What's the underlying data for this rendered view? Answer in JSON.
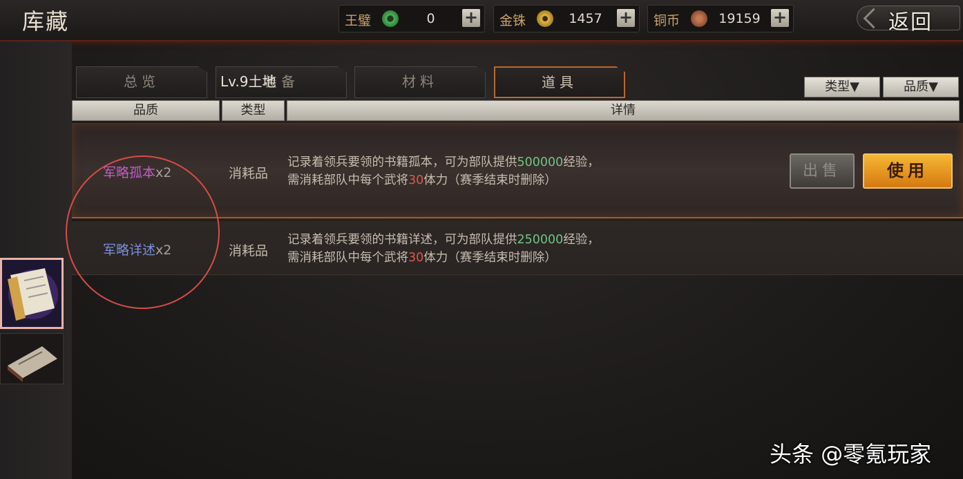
{
  "header": {
    "title": "库藏",
    "back_label": "返回"
  },
  "currencies": [
    {
      "name": "王璧",
      "value": "0",
      "color": "#4fb357"
    },
    {
      "name": "金铢",
      "value": "1457",
      "color": "#c59a2a"
    },
    {
      "name": "铜币",
      "value": "19159",
      "color": "#a0593a"
    }
  ],
  "tabs": [
    {
      "label": "总览"
    },
    {
      "label": "装备",
      "overlay": "Lv.9土地"
    },
    {
      "label": "材料"
    },
    {
      "label": "道具",
      "active": true
    }
  ],
  "filters": {
    "type_label": "类型▼",
    "quality_label": "品质▼"
  },
  "table": {
    "headers": [
      "品质",
      "类型",
      "详情"
    ]
  },
  "items": [
    {
      "name": "军略孤本",
      "name_color": "#c25cc8",
      "qty": "x2",
      "type": "消耗品",
      "desc_a": "记录着领兵要领的书籍孤本，可为部队提供",
      "exp": "500000",
      "desc_b": "经验，",
      "desc_c": "需消耗部队中每个武将",
      "stamina": "30",
      "desc_d": "体力（赛季结束时删除）"
    },
    {
      "name": "军略详述",
      "name_color": "#7a8fd8",
      "qty": "x2",
      "type": "消耗品",
      "desc_a": "记录着领兵要领的书籍详述，可为部队提供",
      "exp": "250000",
      "desc_b": "经验，",
      "desc_c": "需消耗部队中每个武将",
      "stamina": "30",
      "desc_d": "体力（赛季结束时删除）"
    }
  ],
  "actions": {
    "sell_label": "出售",
    "use_label": "使用"
  },
  "watermark": "头条 @零氪玩家"
}
